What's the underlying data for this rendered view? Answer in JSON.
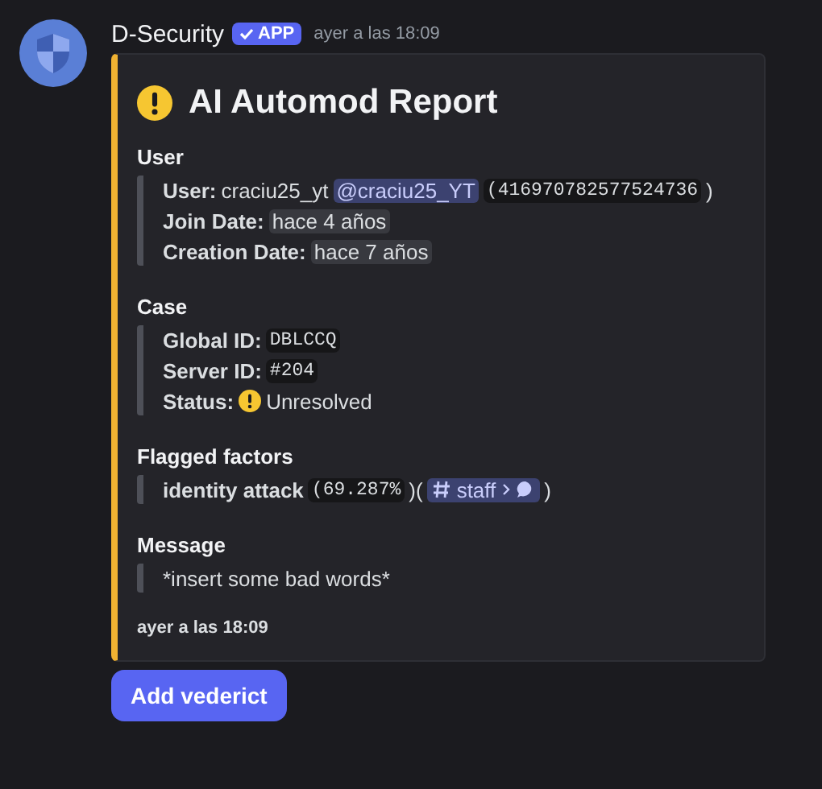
{
  "message": {
    "author": "D-Security",
    "badge": "APP",
    "timestamp": "ayer a las 18:09"
  },
  "embed": {
    "title": "AI Automod Report",
    "sections": [
      {
        "heading": "User",
        "lines": [
          [
            {
              "kind": "label",
              "text": "User:"
            },
            {
              "kind": "text",
              "text": "craciu25_yt"
            },
            {
              "kind": "mention",
              "text": "@craciu25_YT"
            },
            {
              "kind": "code",
              "text": "(416970782577524736"
            },
            {
              "kind": "text",
              "text": ")"
            }
          ],
          [
            {
              "kind": "label",
              "text": "Join Date:"
            },
            {
              "kind": "chip",
              "text": "hace 4 años"
            }
          ],
          [
            {
              "kind": "label",
              "text": "Creation Date:"
            },
            {
              "kind": "chip",
              "text": "hace 7 años"
            }
          ]
        ]
      },
      {
        "heading": "Case",
        "lines": [
          [
            {
              "kind": "label",
              "text": "Global ID:"
            },
            {
              "kind": "code",
              "text": "DBLCCQ"
            }
          ],
          [
            {
              "kind": "label",
              "text": "Server ID:"
            },
            {
              "kind": "code",
              "text": "#204"
            }
          ],
          [
            {
              "kind": "label",
              "text": "Status:"
            },
            {
              "kind": "warning"
            },
            {
              "kind": "text",
              "text": "Unresolved"
            }
          ]
        ]
      },
      {
        "heading": "Flagged factors",
        "lines": [
          [
            {
              "kind": "label",
              "text": "identity attack"
            },
            {
              "kind": "code",
              "text": "(69.287%"
            },
            {
              "kind": "text",
              "text": ")("
            },
            {
              "kind": "channel",
              "text": "staff"
            },
            {
              "kind": "text",
              "text": ")"
            }
          ]
        ]
      },
      {
        "heading": "Message",
        "lines": [
          [
            {
              "kind": "text",
              "text": "*insert some bad words*"
            }
          ]
        ]
      }
    ],
    "footer": "ayer a las 18:09"
  },
  "button": "Add vederict"
}
